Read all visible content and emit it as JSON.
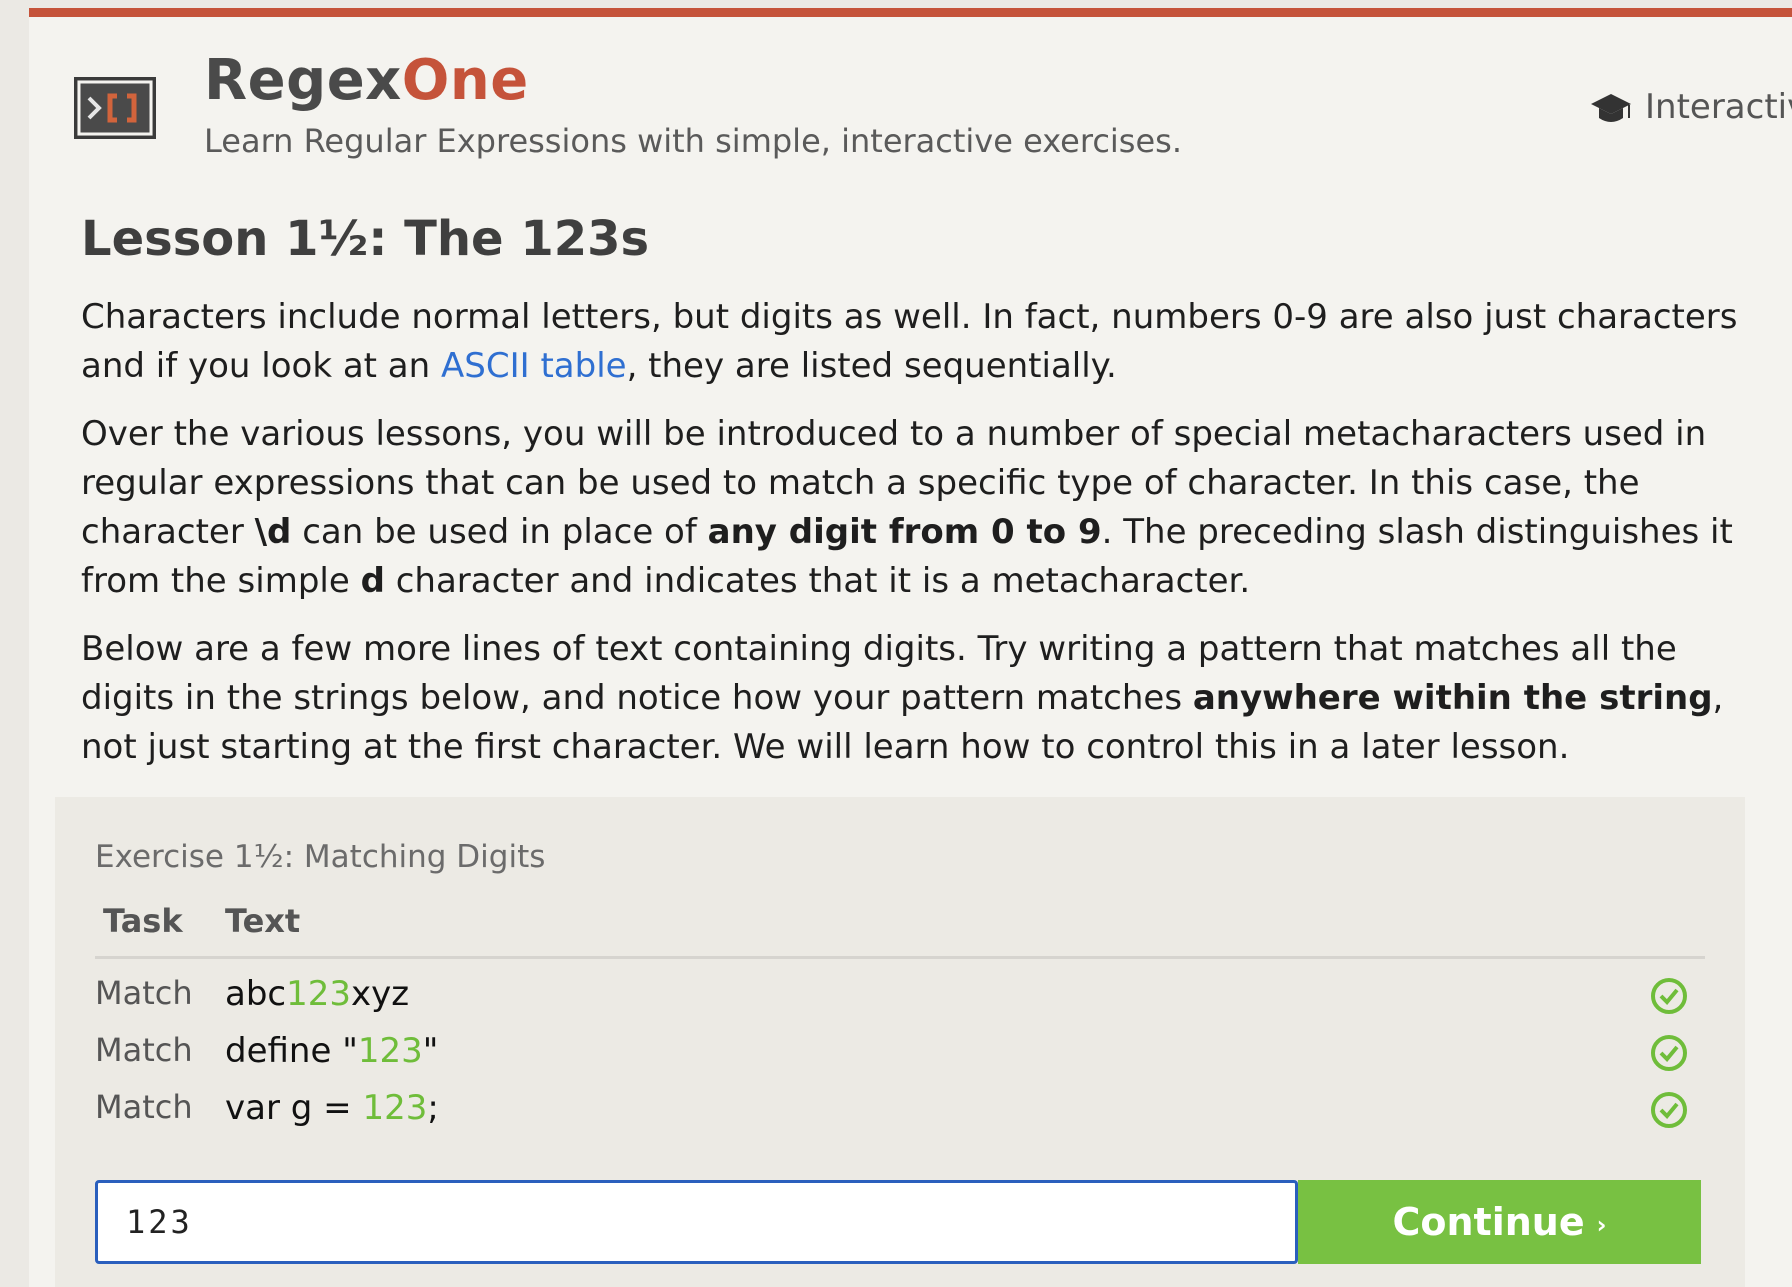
{
  "header": {
    "brand_part1": "Regex",
    "brand_part2": "One",
    "tagline": "Learn Regular Expressions with simple, interactive exercises.",
    "nav_link": "Interactive"
  },
  "lesson": {
    "title": "Lesson 1½: The 123s",
    "p1": {
      "before": "Characters include normal letters, but digits as well. In fact, numbers 0-9 are also just characters and if you look at an ",
      "link": "ASCII table",
      "after": ", they are listed sequentially."
    },
    "p2": {
      "t1": "Over the various lessons, you will be introduced to a number of special metacharacters used in regular expressions that can be used to match a specific type of character. In this case, the character ",
      "b1": "\\d",
      "t2": " can be used in place of ",
      "b2": "any digit from 0 to 9",
      "t3": ". The preceding slash distinguishes it from the simple ",
      "b3": "d",
      "t4": " character and indicates that it is a metacharacter."
    },
    "p3": {
      "t1": "Below are a few more lines of text containing digits. Try writing a pattern that matches all the digits in the strings below, and notice how your pattern matches ",
      "b1": "anywhere within the string",
      "t2": ", not just starting at the first character. We will learn how to control this in a later lesson."
    }
  },
  "exercise": {
    "title": "Exercise 1½: Matching Digits",
    "col_task": "Task",
    "col_text": "Text",
    "rows": [
      {
        "task": "Match",
        "pre": "abc",
        "match": "123",
        "post": "xyz",
        "status": "check-icon"
      },
      {
        "task": "Match",
        "pre": "define \"",
        "match": "123",
        "post": "\"",
        "status": "check-icon"
      },
      {
        "task": "Match",
        "pre": "var g = ",
        "match": "123",
        "post": ";",
        "status": "check-icon"
      }
    ],
    "input_value": "123",
    "continue_label": "Continue",
    "continue_chevron": "›"
  },
  "colors": {
    "accent": "#c5533a",
    "link": "#2f6fd1",
    "match_highlight": "#6fbd3a",
    "continue_button": "#78c142",
    "input_border": "#2a5fbd"
  }
}
